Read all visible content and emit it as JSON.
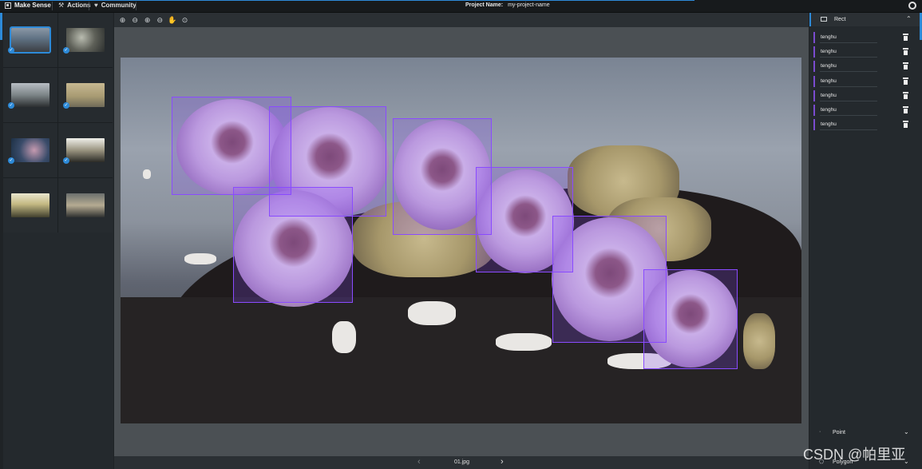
{
  "app": {
    "brand": "Make Sense",
    "menu": [
      {
        "label": "Actions",
        "icon": "tools-icon"
      },
      {
        "label": "Community",
        "icon": "heart-icon"
      }
    ],
    "project_label": "Project Name:",
    "project_name": "my-project-name",
    "accent_color": "#2d8ad8",
    "box_color": "#8a4bff"
  },
  "toolbar": {
    "tools": [
      {
        "name": "zoom-in-icon",
        "glyph": "⊕"
      },
      {
        "name": "zoom-out-icon",
        "glyph": "⊖"
      },
      {
        "name": "zoom-fit-icon",
        "glyph": "⊕"
      },
      {
        "name": "zoom-max-icon",
        "glyph": "⊖"
      },
      {
        "name": "hand-icon",
        "glyph": "✋"
      },
      {
        "name": "crosshair-icon",
        "glyph": "⊙"
      }
    ]
  },
  "images": [
    {
      "selected": true,
      "checked": true
    },
    {
      "selected": false,
      "checked": true
    },
    {
      "selected": false,
      "checked": true
    },
    {
      "selected": false,
      "checked": true
    },
    {
      "selected": false,
      "checked": true
    },
    {
      "selected": false,
      "checked": true
    },
    {
      "selected": false,
      "checked": false
    },
    {
      "selected": false,
      "checked": false
    }
  ],
  "canvas": {
    "file_name": "01.jpg",
    "prev": "‹",
    "next": "›"
  },
  "right_panel": {
    "active_tool": "Rect",
    "labels": [
      "tenghu",
      "tenghu",
      "tenghu",
      "tenghu",
      "tenghu",
      "tenghu",
      "tenghu"
    ],
    "other_tools": [
      {
        "label": "Point",
        "icon": "point-icon"
      },
      {
        "label": "Polygon",
        "icon": "polygon-icon"
      }
    ]
  },
  "watermark": "CSDN @帕里亚"
}
